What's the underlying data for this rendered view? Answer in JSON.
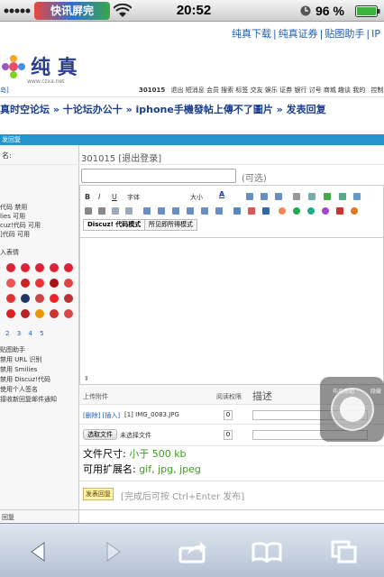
{
  "status_bar": {
    "carrier": "快讯屏完",
    "time": "20:52",
    "battery": "96 %"
  },
  "top_links": [
    "纯真下载",
    "|",
    "纯真证券",
    "|",
    "贴图助手",
    "|",
    "IP"
  ],
  "logo": {
    "text": "纯 真",
    "url_text": "www.czxa.net"
  },
  "subnav": {
    "user": "301015",
    "items": [
      "退出",
      "短消息",
      "会员",
      "搜索",
      "标签",
      "交友",
      "娱乐",
      "证券",
      "银行",
      "讨号",
      "商城",
      "趣谈",
      "我的"
    ],
    "right": "控制面板"
  },
  "left_stub": "岛]",
  "breadcrumb": "真时空论坛 » 十论坛办公十 » iphone手機發帖上傳不了圖片 » 发表回复",
  "section_bar": "发回复",
  "form": {
    "name_label": "名:",
    "username": "301015 [退出登录]",
    "title_optional": "(可选)",
    "font_label": "字体",
    "size_label": "大小",
    "tab_discuz": "Discuz! 代码模式",
    "tab_wysiwyg": "所见即所得模式"
  },
  "left_panel": {
    "code_lines": [
      "代码 禁用",
      "lies 可用",
      "cuz!代码 可用",
      "]代码 可用"
    ],
    "smilies_title": "入表情",
    "pages": [
      "2",
      "3",
      "4",
      "5"
    ],
    "options": [
      "贴图助手",
      "禁用 URL 识别",
      "禁用 Smilies",
      "禁用 Discuz!代码",
      "使用个人签名",
      "接收新回复邮件通知"
    ]
  },
  "attachments": {
    "col_attach": "上传附件",
    "col_perm": "阅读权限",
    "col_desc": "描述",
    "row1_actions": "[删除] [插入]",
    "row1_file": "[1] IMG_0083.JPG",
    "row1_perm": "0",
    "choose_file": "选取文件",
    "no_file": "未选择文件",
    "row2_perm": "0",
    "file_size_label": "文件尺寸: ",
    "file_size_value": "小于 500 kb",
    "ext_label": "可用扩展名: ",
    "ext_value": "gif, jpg, jpeg"
  },
  "submit": {
    "button": "发表回复",
    "hint": "[完成后可按 Ctrl+Enter 发布]"
  },
  "overlay_labels": [
    "布局帮助",
    "隐藏"
  ],
  "footer_stub": "回复",
  "icons": [
    "back-icon",
    "forward-icon",
    "share-icon",
    "bookmarks-icon",
    "tabs-icon",
    "wifi-icon",
    "lock-icon",
    "battery-icon"
  ]
}
